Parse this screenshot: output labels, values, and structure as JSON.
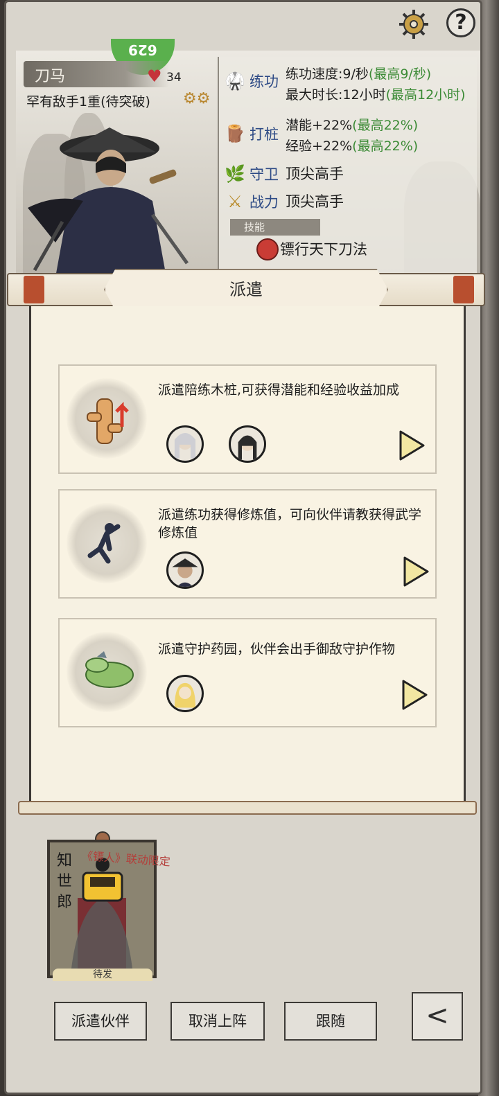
{
  "profile": {
    "name": "刀马",
    "hp": "34",
    "rank": "罕有敌手1重(待突破)",
    "badge": "629"
  },
  "stats": {
    "train": {
      "label": "练功",
      "speed": "练功速度:9/秒",
      "speed_max": "(最高9/秒)",
      "duration": "最大时长:12小时",
      "duration_max": "(最高12小时)"
    },
    "stake": {
      "label": "打桩",
      "potential": "潜能+22%",
      "potential_max": "(最高22%)",
      "exp": "经验+22%",
      "exp_max": "(最高22%)"
    },
    "guard": {
      "label": "守卫",
      "value": "顶尖高手"
    },
    "power": {
      "label": "战力",
      "value": "顶尖高手"
    },
    "skill_header": "技能",
    "skill": "镖行天下刀法"
  },
  "dialog": {
    "title": "派遣",
    "cards": [
      {
        "text": "派遣陪练木桩,可获得潜能和经验收益加成",
        "icon": "wooden-stake-icon"
      },
      {
        "text": "派遣练功获得修炼值，可向伙伴请教获得武学修炼值",
        "icon": "martial-artist-icon"
      },
      {
        "text": "派遣守护药园，伙伴会出手御敌守护作物",
        "icon": "herb-garden-icon"
      }
    ]
  },
  "companion": {
    "name": "知世郎",
    "collab": "《镖人》联动限定",
    "bottom": "待发"
  },
  "buttons": {
    "dispatch": "派遣伙伴",
    "cancel": "取消上阵",
    "follow": "跟随"
  },
  "colors": {
    "accent_green": "#3c8b36",
    "label_blue": "#2d4a85",
    "panel": "#f6f1e2"
  }
}
